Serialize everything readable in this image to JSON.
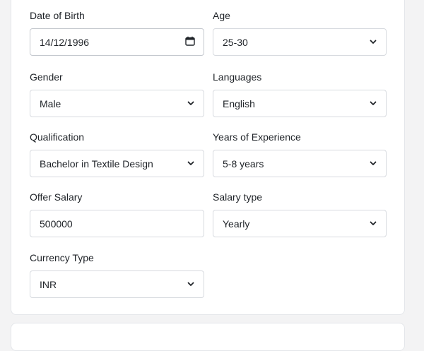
{
  "form": {
    "date_of_birth": {
      "label": "Date of Birth",
      "value": "14/12/1996",
      "icon": "calendar-icon"
    },
    "age": {
      "label": "Age",
      "value": "25-30"
    },
    "gender": {
      "label": "Gender",
      "value": "Male"
    },
    "languages": {
      "label": "Languages",
      "value": "English"
    },
    "qualification": {
      "label": "Qualification",
      "value": "Bachelor in Textile Design"
    },
    "experience": {
      "label": "Years of Experience",
      "value": "5-8 years"
    },
    "offer_salary": {
      "label": "Offer Salary",
      "value": "500000"
    },
    "salary_type": {
      "label": "Salary type",
      "value": "Yearly"
    },
    "currency_type": {
      "label": "Currency Type",
      "value": "INR"
    }
  },
  "colors": {
    "page_background": "#f3f3f4",
    "card_background": "#ffffff",
    "border": "#d7dadf",
    "text": "#1f2328"
  }
}
